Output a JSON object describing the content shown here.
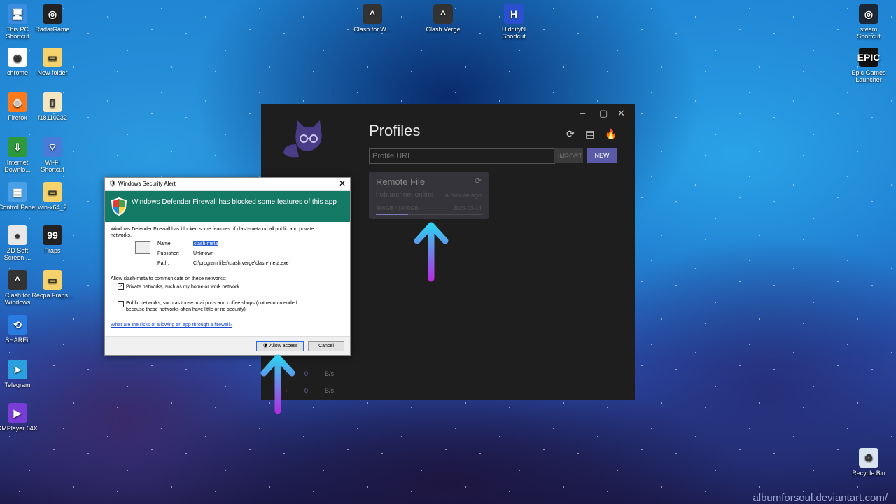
{
  "desktop": {
    "icons_left": [
      {
        "label": "This PC\nShortcut",
        "icon": "computer-icon"
      },
      {
        "label": "RadarGame",
        "icon": "radar-icon"
      },
      {
        "label": "chrome",
        "icon": "chrome-icon"
      },
      {
        "label": "New folder",
        "icon": "folder-icon"
      },
      {
        "label": "Firefox",
        "icon": "firefox-icon"
      },
      {
        "label": "f18110232",
        "icon": "file-icon"
      },
      {
        "label": "Internet\nDownlo...",
        "icon": "idm-icon"
      },
      {
        "label": "Wi-Fi\nShortcut",
        "icon": "wifi-icon"
      },
      {
        "label": "Control Panel",
        "icon": "control-panel-icon"
      },
      {
        "label": "win-x64_2",
        "icon": "folder-icon"
      },
      {
        "label": "ZD Soft\nScreen ...",
        "icon": "record-icon"
      },
      {
        "label": "Fraps",
        "icon": "fraps-icon"
      },
      {
        "label": "Clash for\nWindows",
        "icon": "cat-icon"
      },
      {
        "label": "Recpa.Fraps...",
        "icon": "folder-icon"
      },
      {
        "label": "SHAREit",
        "icon": "shareit-icon"
      },
      {
        "label": "Telegram",
        "icon": "telegram-icon"
      },
      {
        "label": "KMPlayer 64X",
        "icon": "kmplayer-icon"
      }
    ],
    "icons_top": [
      {
        "label": "Clash.for.W...",
        "icon": "cat-icon"
      },
      {
        "label": "Clash Verge",
        "icon": "cat-icon"
      },
      {
        "label": "HiddifyN\nShortcut",
        "icon": "hiddify-icon"
      }
    ],
    "icons_right": [
      {
        "label": "steam\nShortcut",
        "icon": "steam-icon"
      },
      {
        "label": "Epic Games\nLauncher",
        "icon": "epic-icon",
        "text": "EPIC"
      },
      {
        "label": "Recycle Bin",
        "icon": "recycle-bin-icon"
      }
    ],
    "watermark": "albumforsoul.deviantart.com/"
  },
  "clash_window": {
    "title": "Profiles",
    "url_placeholder": "Profile URL",
    "import_label": "IMPORT",
    "new_label": "NEW",
    "profile": {
      "name": "Remote File",
      "host": "hub.archnet.online",
      "updated": "a minute ago",
      "usage": "306GB / 1000GB",
      "expire": "2025-03-14",
      "usage_fraction": 0.306
    },
    "traffic": {
      "up_value": "0",
      "up_unit": "B/s",
      "down_value": "0",
      "down_unit": "B/s"
    }
  },
  "security_alert": {
    "title": "Windows Security Alert",
    "headline": "Windows Defender Firewall has blocked some features of this app",
    "description": "Windows Defender Firewall has blocked some features of clash-meta on all public and private networks.",
    "name_label": "Name:",
    "name_value": "clash-meta",
    "publisher_label": "Publisher:",
    "publisher_value": "Unknown",
    "path_label": "Path:",
    "path_value": "C:\\program files\\clash verge\\clash-meta.exe",
    "allow_prompt": "Allow clash-meta to communicate on these networks:",
    "private_label": "Private networks, such as my home or work network",
    "private_checked": true,
    "public_label": "Public networks, such as those in airports and coffee shops (not recommended because these networks often have little or no security)",
    "public_checked": false,
    "risk_link": "What are the risks of allowing an app through a firewall?",
    "allow_button": "Allow access",
    "cancel_button": "Cancel"
  },
  "colors": {
    "accent_purple": "#5a5aa8",
    "firewall_green": "#147a66",
    "arrow_cyan": "#2fd0f0",
    "arrow_purple": "#b030e0"
  }
}
